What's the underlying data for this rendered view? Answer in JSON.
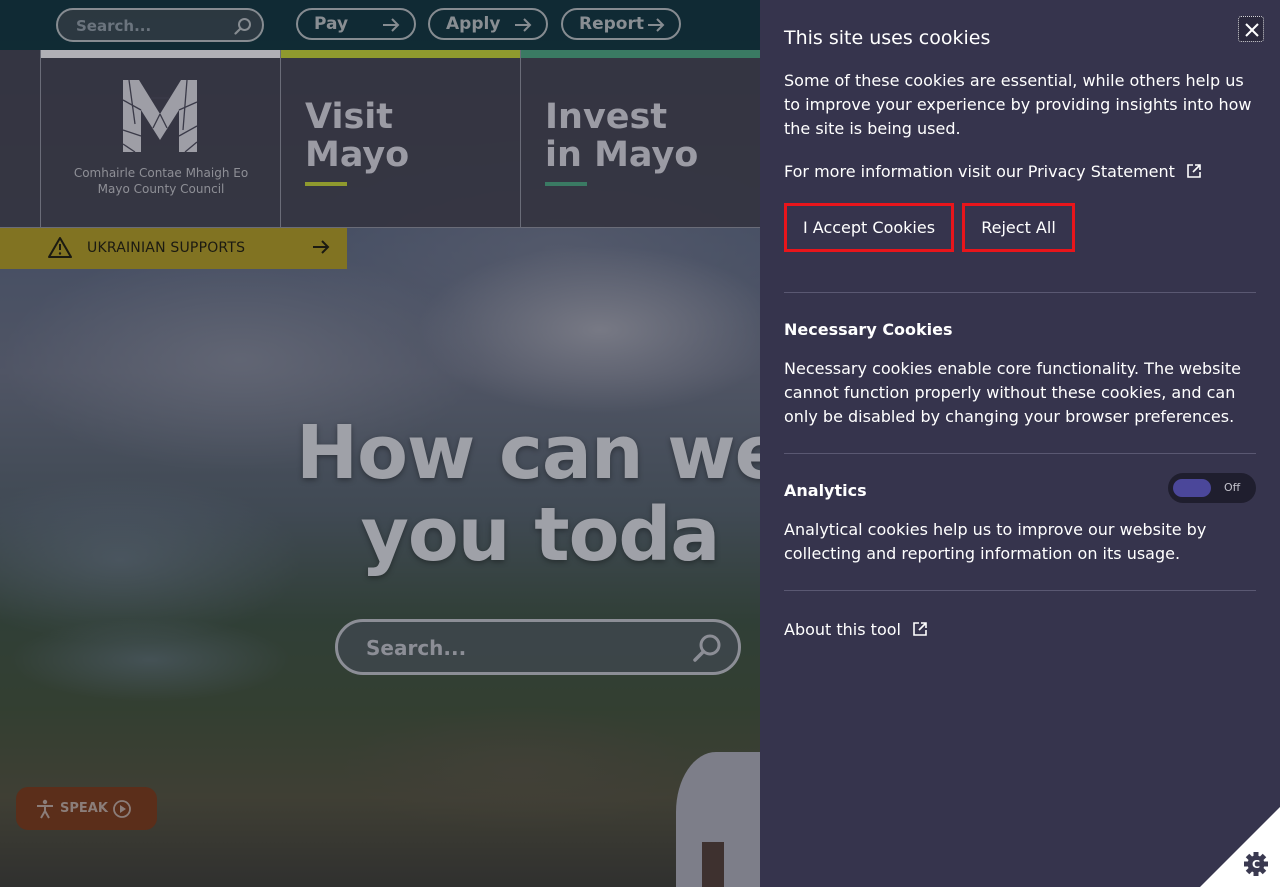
{
  "top_bar": {
    "search_placeholder": "Search...",
    "quick_links": [
      {
        "label": "Pay"
      },
      {
        "label": "Apply"
      },
      {
        "label": "Report"
      }
    ]
  },
  "nav": {
    "logo": {
      "irish_name": "Comhairle Contae Mhaigh Eo",
      "english_name": "Mayo County Council"
    },
    "tiles": [
      {
        "line1": "Visit",
        "line2": "Mayo",
        "accent": "#8f9a2e"
      },
      {
        "line1": "Invest",
        "line2": "in Mayo",
        "accent": "#3a7a63"
      }
    ],
    "logo_accent": "#b0b0b6"
  },
  "alert_banner": {
    "label": "UKRAINIAN SUPPORTS",
    "color": "#817322"
  },
  "hero": {
    "title_line1": "How can we",
    "title_line2": "you toda",
    "search_placeholder": "Search..."
  },
  "speak_widget": {
    "label": "SPEAK"
  },
  "cookie_panel": {
    "title": "This site uses cookies",
    "intro": "Some of these cookies are essential, while others help us to improve your experience by providing insights into how the site is being used.",
    "more_info_prefix": "For more information visit our",
    "privacy_link": "Privacy Statement",
    "accept_label": "I Accept Cookies",
    "reject_label": "Reject All",
    "necessary": {
      "title": "Necessary Cookies",
      "text": "Necessary cookies enable core functionality. The website cannot function properly without these cookies, and can only be disabled by changing your browser preferences."
    },
    "analytics": {
      "title": "Analytics",
      "toggle_state": "Off",
      "text": "Analytical cookies help us to improve our website by collecting and reporting information on its usage."
    },
    "about_link": "About this tool",
    "colors": {
      "panel_bg": "#36344d",
      "button_border": "#e8151b",
      "toggle_knob": "#4b479a"
    }
  }
}
